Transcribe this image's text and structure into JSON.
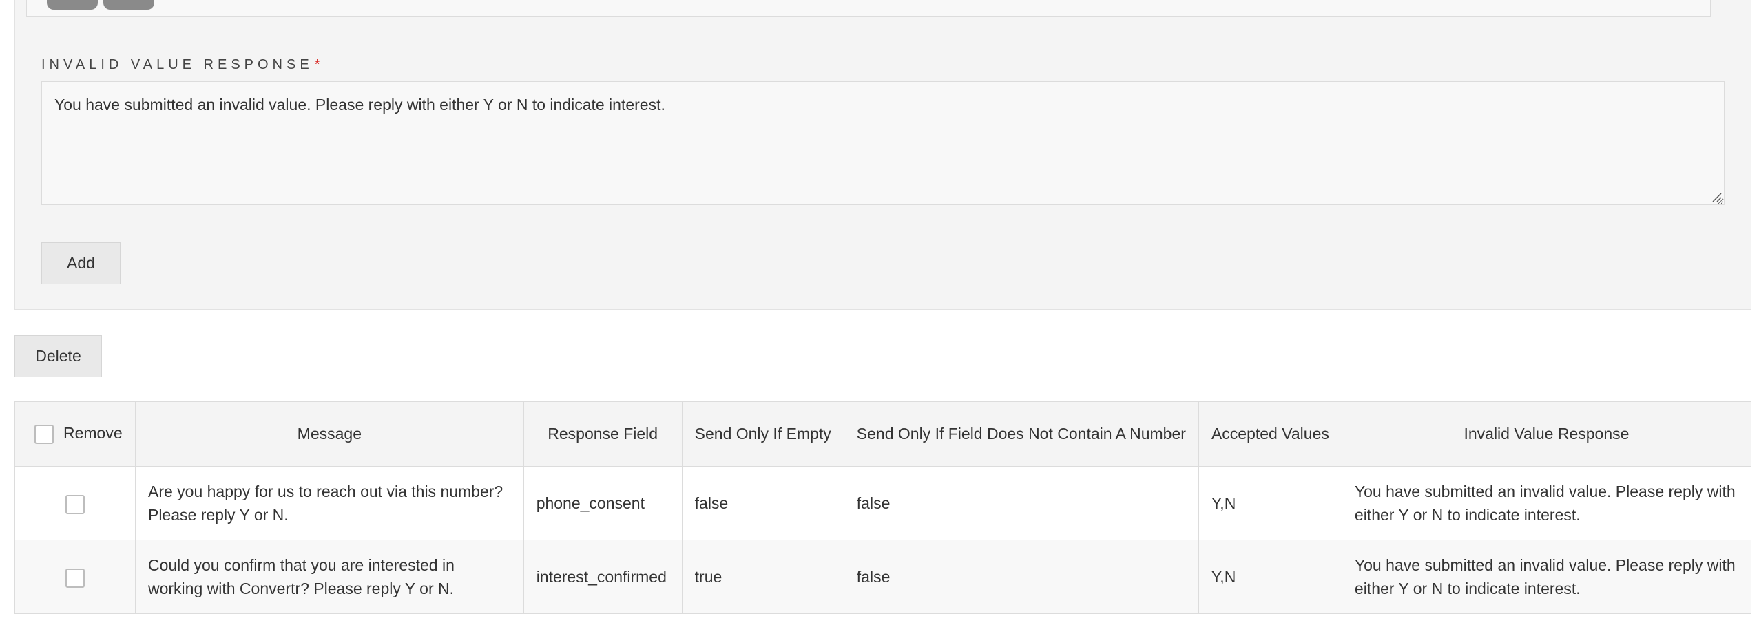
{
  "form": {
    "invalid_value_label": "INVALID VALUE RESPONSE",
    "required_marker": "*",
    "invalid_value_text": "You have submitted an invalid value. Please reply with either Y or N to indicate interest.",
    "add_label": "Add"
  },
  "toolbar": {
    "delete_label": "Delete"
  },
  "table": {
    "headers": {
      "remove": "Remove",
      "message": "Message",
      "response_field": "Response Field",
      "send_only_if_empty": "Send Only If Empty",
      "send_only_if_no_number": "Send Only If Field Does Not Contain A Number",
      "accepted_values": "Accepted Values",
      "invalid_value_response": "Invalid Value Response"
    },
    "rows": [
      {
        "message": "Are you happy for us to reach out via this number? Please reply Y or N.",
        "response_field": "phone_consent",
        "send_only_if_empty": "false",
        "send_only_if_no_number": "false",
        "accepted_values": "Y,N",
        "invalid_value_response": "You have submitted an invalid value. Please reply with either Y or N to indicate interest."
      },
      {
        "message": "Could you confirm that you are interested in working with Convertr? Please reply Y or N.",
        "response_field": "interest_confirmed",
        "send_only_if_empty": "true",
        "send_only_if_no_number": "false",
        "accepted_values": "Y,N",
        "invalid_value_response": "You have submitted an invalid value. Please reply with either Y or N to indicate interest."
      }
    ]
  }
}
